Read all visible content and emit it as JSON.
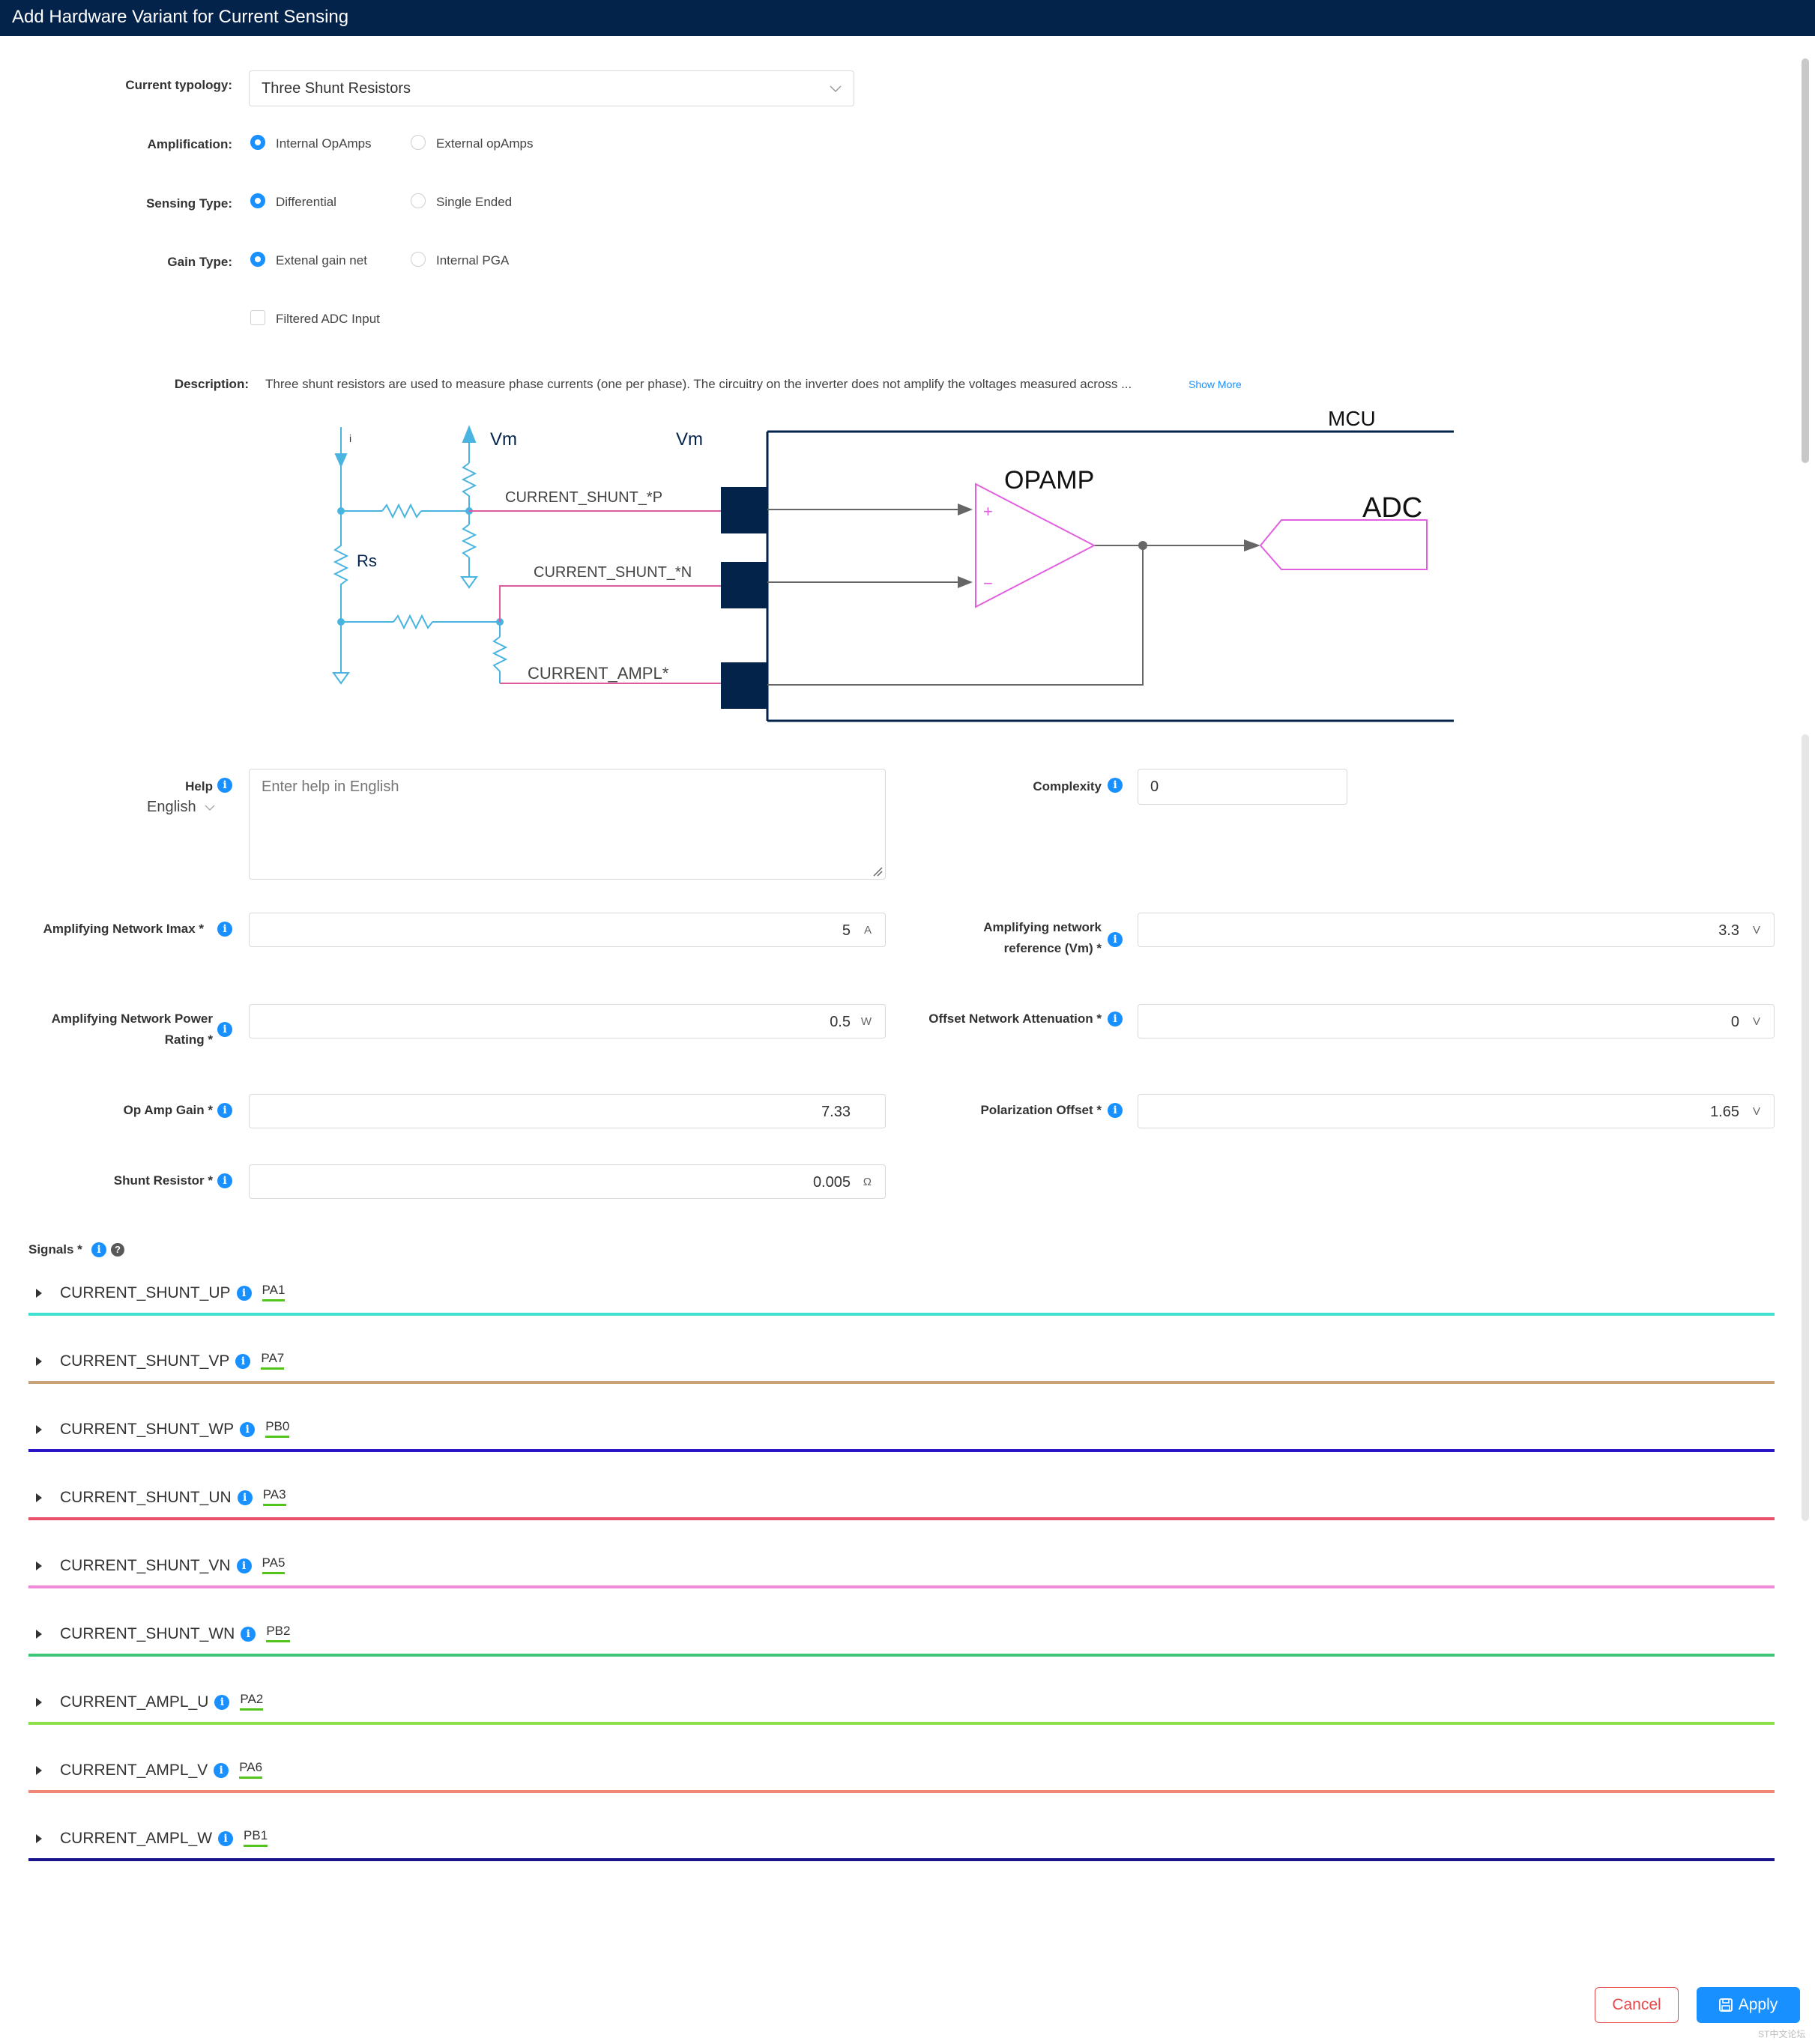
{
  "window": {
    "title": "Add Hardware Variant for Current Sensing"
  },
  "form": {
    "typology_label": "Current typology:",
    "typology_value": "Three Shunt Resistors",
    "amplification_label": "Amplification:",
    "amplification_options": [
      "Internal OpAmps",
      "External opAmps"
    ],
    "sensing_label": "Sensing Type:",
    "sensing_options": [
      "Differential",
      "Single Ended"
    ],
    "gain_label": "Gain Type:",
    "gain_options": [
      "Extenal gain net",
      "Internal PGA"
    ],
    "filtered_label": "Filtered ADC Input",
    "description_label": "Description:",
    "description_text": "Three shunt resistors are used to measure phase currents (one per phase). The circuitry on the inverter does not amplify the voltages measured across ...",
    "show_more": "Show More"
  },
  "diagram": {
    "i_label": "i",
    "vm1": "Vm",
    "vm2": "Vm",
    "rs": "Rs",
    "mcu": "MCU",
    "opamp": "OPAMP",
    "adc": "ADC",
    "plus": "+",
    "minus": "−",
    "sig_p": "CURRENT_SHUNT_*P",
    "sig_n": "CURRENT_SHUNT_*N",
    "sig_ampl": "CURRENT_AMPL*"
  },
  "params": {
    "help_label": "Help",
    "help_lang": "English",
    "help_placeholder": "Enter help in English",
    "complexity_label": "Complexity",
    "complexity_value": "0",
    "imax_label": "Amplifying Network Imax *",
    "imax_value": "5",
    "imax_unit": "A",
    "vm_label_1": "Amplifying network",
    "vm_label_2": "reference (Vm) *",
    "vm_value": "3.3",
    "vm_unit": "V",
    "power_label_1": "Amplifying Network Power",
    "power_label_2": "Rating *",
    "power_value": "0.5",
    "power_unit": "W",
    "offset_att_label": "Offset Network Attenuation *",
    "offset_att_value": "0",
    "offset_att_unit": "V",
    "gain_label": "Op Amp Gain *",
    "gain_value": "7.33",
    "pol_label": "Polarization Offset *",
    "pol_value": "1.65",
    "pol_unit": "V",
    "shunt_label": "Shunt Resistor *",
    "shunt_value": "0.005",
    "shunt_unit": "Ω"
  },
  "signals": {
    "label": "Signals *",
    "items": [
      {
        "name": "CURRENT_SHUNT_UP",
        "pin": "PA1",
        "color": "#40e0d0"
      },
      {
        "name": "CURRENT_SHUNT_VP",
        "pin": "PA7",
        "color": "#c8a07a"
      },
      {
        "name": "CURRENT_SHUNT_WP",
        "pin": "PB0",
        "color": "#2a16c8"
      },
      {
        "name": "CURRENT_SHUNT_UN",
        "pin": "PA3",
        "color": "#e8506a"
      },
      {
        "name": "CURRENT_SHUNT_VN",
        "pin": "PA5",
        "color": "#f08ad8"
      },
      {
        "name": "CURRENT_SHUNT_WN",
        "pin": "PB2",
        "color": "#3cc878"
      },
      {
        "name": "CURRENT_AMPL_U",
        "pin": "PA2",
        "color": "#8ee04a"
      },
      {
        "name": "CURRENT_AMPL_V",
        "pin": "PA6",
        "color": "#f08878"
      },
      {
        "name": "CURRENT_AMPL_W",
        "pin": "PB1",
        "color": "#1a148c"
      }
    ]
  },
  "footer": {
    "cancel": "Cancel",
    "apply": "Apply",
    "watermark": "ST中文论坛"
  }
}
